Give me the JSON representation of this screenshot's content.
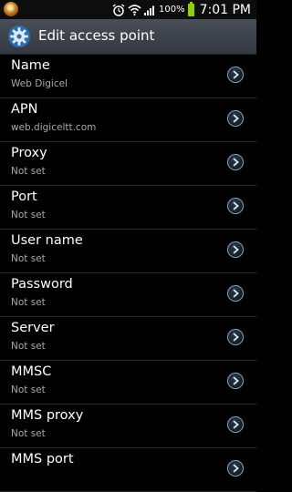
{
  "status_bar": {
    "battery_percent": "100%",
    "time": "7:01 PM",
    "icons": [
      "notification-icon",
      "alarm-icon",
      "wifi-icon",
      "signal-icon",
      "battery-icon"
    ]
  },
  "header": {
    "title": "Edit access point",
    "icon": "settings-gear-icon"
  },
  "colors": {
    "background": "#000000",
    "title_bar": "#3e424a",
    "secondary_text": "#a9a9a9",
    "chevron_ring": "#7fa8c8",
    "battery": "#8ed100"
  },
  "settings": [
    {
      "label": "Name",
      "value": "Web Digicel"
    },
    {
      "label": "APN",
      "value": "web.digiceltt.com"
    },
    {
      "label": "Proxy",
      "value": "Not set"
    },
    {
      "label": "Port",
      "value": "Not set"
    },
    {
      "label": "User name",
      "value": "Not set"
    },
    {
      "label": "Password",
      "value": "Not set"
    },
    {
      "label": "Server",
      "value": "Not set"
    },
    {
      "label": "MMSC",
      "value": "Not set"
    },
    {
      "label": "MMS proxy",
      "value": "Not set"
    },
    {
      "label": "MMS port",
      "value": ""
    }
  ]
}
